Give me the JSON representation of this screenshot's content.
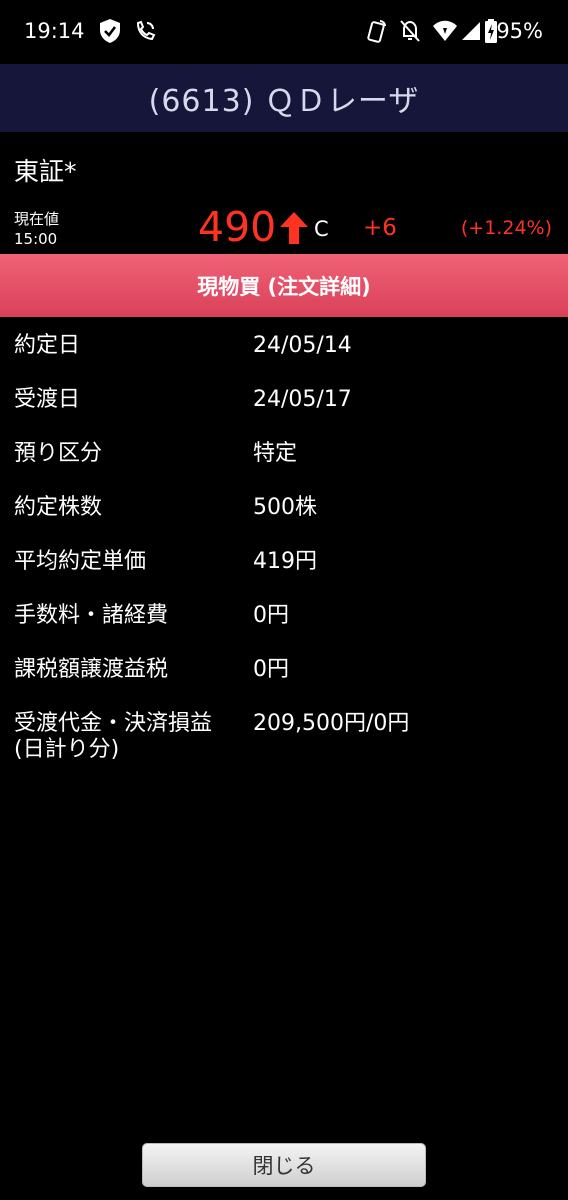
{
  "status_bar": {
    "time": "19:14",
    "battery": "95%",
    "icons": [
      "shield-check-icon",
      "wifi-calling-icon",
      "nfc-icon",
      "bell-off-icon",
      "wifi-icon",
      "signal-icon",
      "battery-charging-icon"
    ]
  },
  "header": {
    "title": "(6613) ＱＤレーザ"
  },
  "stock": {
    "exchange": "東証*",
    "price_label": "現在値",
    "price_time": "15:00",
    "price": "490",
    "flag": "C",
    "change": "+6",
    "change_pct": "(+1.24%)",
    "up_color": "#ff3322"
  },
  "section": {
    "title": "現物買 (注文詳細)",
    "color": "#e3506a"
  },
  "details": [
    {
      "label": "約定日",
      "value": "24/05/14"
    },
    {
      "label": "受渡日",
      "value": "24/05/17"
    },
    {
      "label": "預り区分",
      "value": "特定"
    },
    {
      "label": "約定株数",
      "value": "500株"
    },
    {
      "label": "平均約定単価",
      "value": "419円"
    },
    {
      "label": "手数料・諸経費",
      "value": "0円"
    },
    {
      "label": "課税額譲渡益税",
      "value": "0円"
    },
    {
      "label": "受渡代金・決済損益\n(日計り分)",
      "value": "209,500円/0円"
    }
  ],
  "footer": {
    "close_label": "閉じる"
  }
}
